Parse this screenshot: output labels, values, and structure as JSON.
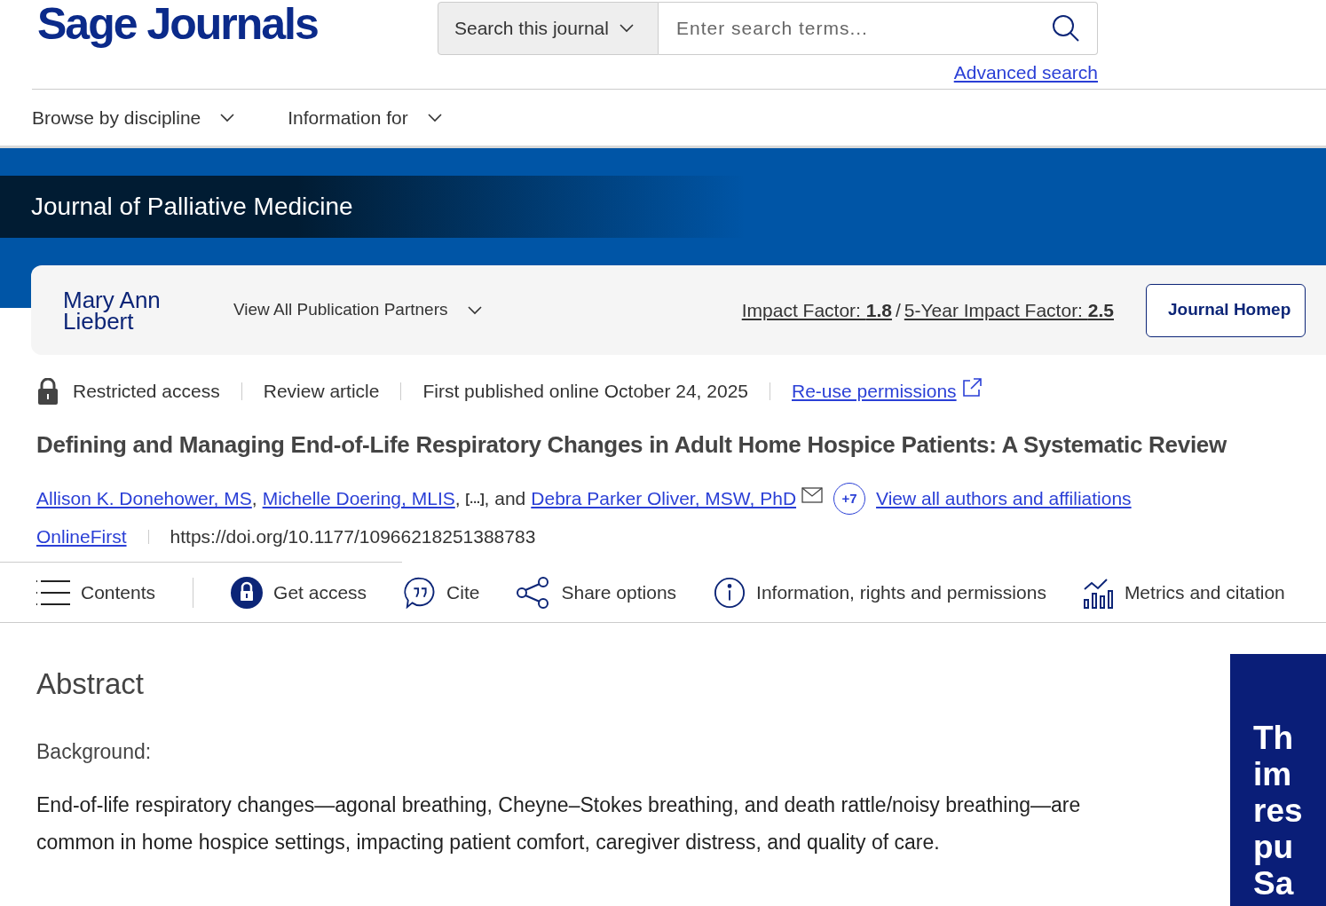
{
  "header": {
    "logo": "Sage Journals",
    "search_scope": "Search this journal",
    "search": {
      "placeholder": "Enter search terms..."
    },
    "advanced_search": "Advanced search"
  },
  "nav": [
    "Browse by discipline",
    "Information for"
  ],
  "journal_title": "Journal of Palliative Medicine",
  "partner": {
    "logo": "Mary Ann Liebert",
    "menu": "View All Publication Partners",
    "impact_factor": "Impact Factor: **1.8**",
    "separator": "/",
    "five_year_impact_factor": "5-Year Impact Factor: **2.5**",
    "homepage_button": "Journal Homep"
  },
  "meta": [
    {
      "kind": "access",
      "text": "Restricted access"
    },
    {
      "kind": "text",
      "text": "Review article"
    },
    {
      "kind": "text",
      "text": "First published online October 24, 2025"
    },
    {
      "kind": "link",
      "text": "Re-use permissions"
    }
  ],
  "article_title": "Defining and Managing End-of-Life Respiratory Changes in Adult Home Hospice Patients: A Systematic Review",
  "authors": [
    {
      "kind": "link",
      "text": "Allison K. Donehower, MS"
    },
    {
      "kind": "text",
      "text": ","
    },
    {
      "kind": "link",
      "text": "Michelle Doering, MLIS"
    },
    {
      "kind": "text",
      "text": ","
    },
    {
      "kind": "ellipsis",
      "text": "[...]"
    },
    {
      "kind": "text",
      "text": ", and"
    },
    {
      "kind": "link",
      "text": "Debra Parker Oliver, MSW, PhD"
    },
    {
      "kind": "email"
    }
  ],
  "more_authors": "+7",
  "view_all_authors": "View all authors and affiliations",
  "issue_link": "OnlineFirst",
  "doi": "https://doi.org/10.1177/10966218251388783",
  "toolbar": [
    "Contents",
    "Get access",
    "Cite",
    "Share options",
    "Information, rights and permissions",
    "Metrics and citation"
  ],
  "abstract": {
    "heading": "Abstract",
    "section": "Background:",
    "paragraph": "End-of-life respiratory changes—agonal breathing, Cheyne–Stokes breathing, and death rattle/noisy breathing—are common in home hospice settings, impacting patient comfort, caregiver distress, and quality of care."
  },
  "ad": [
    "Th",
    "im",
    "res",
    "pu",
    "Sa"
  ]
}
